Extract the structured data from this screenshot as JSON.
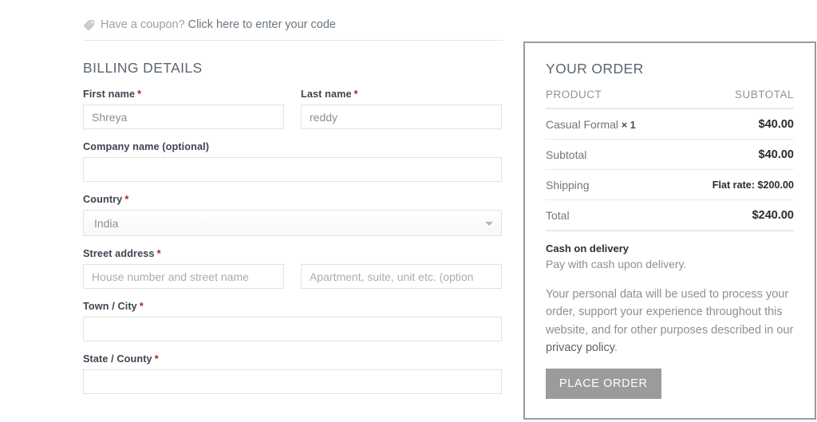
{
  "coupon": {
    "icon": "tag-icon",
    "text": "Have a coupon?",
    "link_label": "Click here to enter your code"
  },
  "billing": {
    "heading": "BILLING DETAILS",
    "required_marker": "*",
    "fields": [
      {
        "label": "First name",
        "required": true,
        "value": "Shreya",
        "placeholder": ""
      },
      {
        "label": "Last name",
        "required": true,
        "value": "reddy",
        "placeholder": ""
      },
      {
        "label": "Company name (optional)",
        "required": false,
        "value": "",
        "placeholder": ""
      },
      {
        "label": "Country",
        "required": true,
        "value": "India",
        "type": "select"
      },
      {
        "label": "Street address",
        "required": true,
        "value": "",
        "placeholder": "House number and street name"
      },
      {
        "label": "",
        "required": false,
        "value": "",
        "placeholder": "Apartment, suite, unit etc. (option"
      },
      {
        "label": "Town / City",
        "required": true,
        "value": "",
        "placeholder": ""
      },
      {
        "label": "State / County",
        "required": true,
        "value": "",
        "placeholder": ""
      }
    ]
  },
  "order": {
    "title": "YOUR ORDER",
    "columns": {
      "product": "PRODUCT",
      "subtotal": "SUBTOTAL"
    },
    "items": [
      {
        "name": "Casual Formal",
        "qty": "× 1",
        "amount": "$40.00"
      }
    ],
    "rows": [
      {
        "label": "Subtotal",
        "value": "$40.00",
        "emphasis": "large"
      },
      {
        "label": "Shipping",
        "value": "Flat rate: $200.00",
        "emphasis": "small"
      },
      {
        "label": "Total",
        "value": "$240.00",
        "emphasis": "large"
      }
    ],
    "payment": {
      "method_title": "Cash on delivery",
      "method_desc": "Pay with cash upon delivery.",
      "privacy_text_before": "Your personal data will be used to process your order, support your experience throughout this website, and for other purposes described in our ",
      "privacy_link": "privacy policy",
      "privacy_text_after": ".",
      "place_order_label": "PLACE ORDER"
    }
  },
  "colors": {
    "required": "#a8232b",
    "panel_border": "#9a9a9a",
    "button_bg": "#9b9b9b",
    "text_muted": "#8a9097"
  }
}
